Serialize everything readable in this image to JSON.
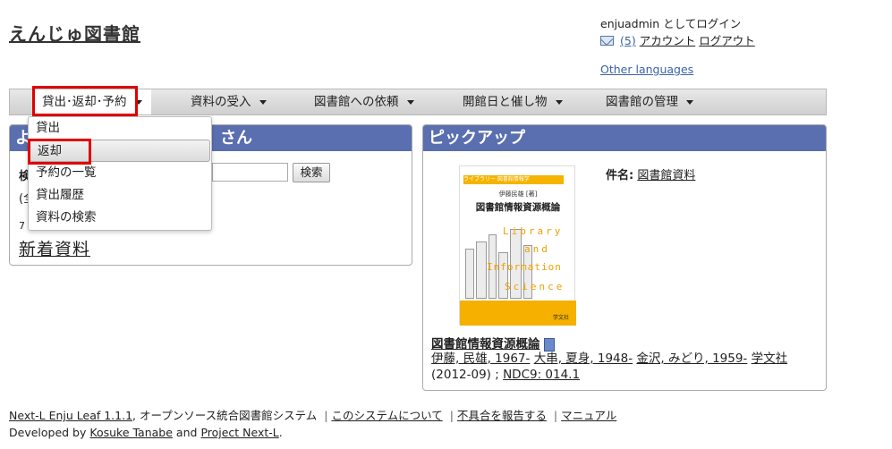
{
  "site": {
    "title": "えんじゅ図書館"
  },
  "user": {
    "login_text": "enjuadmin としてログイン",
    "message_count": "(5)",
    "account_link": "アカウント",
    "logout_link": "ログアウト",
    "other_languages": "Other languages"
  },
  "nav": {
    "items": [
      {
        "label": "貸出･返却･予約"
      },
      {
        "label": "資料の受入"
      },
      {
        "label": "図書館への依頼"
      },
      {
        "label": "開館日と催し物"
      },
      {
        "label": "図書館の管理"
      }
    ]
  },
  "dropdown": {
    "items": [
      {
        "label": "貸出"
      },
      {
        "label": "返却"
      },
      {
        "label": "予約の一覧"
      },
      {
        "label": "貸出履歴"
      },
      {
        "label": "資料の検索"
      }
    ]
  },
  "left_panel": {
    "head_left": "よ",
    "head_right": "さん",
    "frag1": "検",
    "frag2": "(全",
    "frag3": "7",
    "search_button": "検索",
    "new_items_link": "新着資料"
  },
  "pickup": {
    "header": "ピックアップ",
    "subject_label": "件名:",
    "subject_value": "図書館資料",
    "cover": {
      "series_band": "ライブラリー 図書館情報学",
      "author_small": "伊藤民雄 [著]",
      "title": "図書館情報資源概論",
      "words": [
        "Library",
        "and",
        "Information",
        "Science"
      ],
      "publisher_mark": "学文社"
    },
    "book_title": "図書館情報資源概論",
    "authors": [
      "伊藤, 民雄, 1967-",
      "大串, 夏身, 1948-",
      "金沢, みどり, 1959-"
    ],
    "publisher": "学文社",
    "date": "(2012-09) ;",
    "ndc": "NDC9: 014.1"
  },
  "footer": {
    "product": "Next-L Enju Leaf 1.1.1",
    "product_suffix": ", オープンソース統合図書館システム",
    "about": "このシステムについて",
    "report": "不具合を報告する",
    "manual": "マニュアル",
    "developed_by": "Developed by",
    "author": "Kosuke Tanabe",
    "and": "and",
    "org": "Project Next-L",
    "period": "."
  },
  "colors": {
    "panel_header": "#5a6fb0",
    "highlight_box": "#e00000",
    "cover_accent": "#f5b000",
    "link_blue": "#3b62a8"
  }
}
